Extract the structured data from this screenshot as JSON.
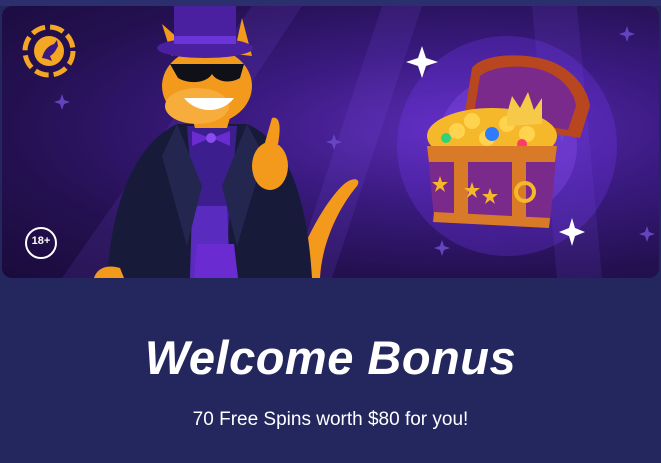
{
  "banner": {
    "age_badge": "18+",
    "logo_icon": "kangaroo-chip-logo-icon",
    "mascot": "kangaroo-mascot-thumbs-up",
    "treasure": "treasure-chest-icon",
    "colors": {
      "banner_bg": "#3a1a80",
      "accent_gold": "#f5a623",
      "mascot_orange": "#f39a1d",
      "suit_navy": "#181a3a",
      "tie_purple": "#6a2bd0"
    }
  },
  "promo": {
    "title": "Welcome Bonus",
    "subtitle": "70 Free Spins worth $80 for you!"
  },
  "colors": {
    "page_bg": "#23275e",
    "text": "#ffffff"
  }
}
